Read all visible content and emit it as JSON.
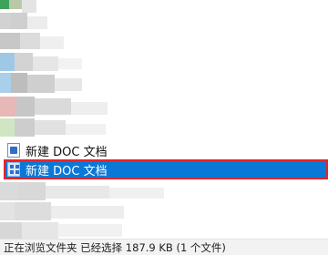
{
  "files": [
    {
      "name": "新建 DOC 文档",
      "selected": false,
      "icon": "doc-file-icon"
    },
    {
      "name": "新建 DOC 文档",
      "selected": true,
      "icon": "doc-file-icon"
    }
  ],
  "status": {
    "text": "正在浏览文件夹 已经选择 187.9 KB (1 个文件)"
  },
  "colors": {
    "selection": "#0a78d7",
    "highlight_border": "#e0262d",
    "status_bg": "#f2f2f2"
  }
}
